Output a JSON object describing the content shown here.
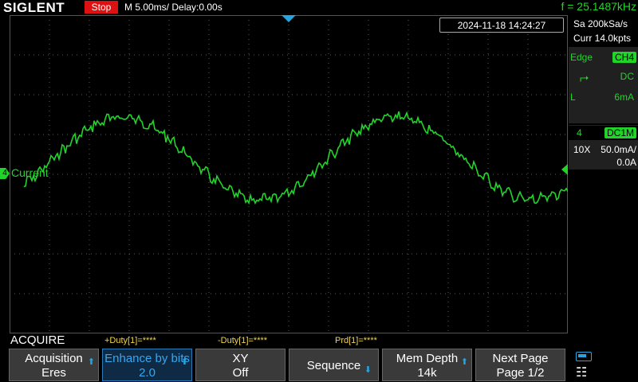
{
  "header": {
    "brand": "SIGLENT",
    "run_state": "Stop",
    "timebase": "M 5.00ms/ Delay:0.00s",
    "frequency": "f = 25.1487kHz"
  },
  "datetime": "2024-11-18 14:24:27",
  "acquisition_info": {
    "sample_rate": "Sa 200kSa/s",
    "memory": "Curr 14.0kpts"
  },
  "trigger": {
    "type": "Edge",
    "source": "CH4",
    "slope_symbol": "⮣",
    "coupling": "DC",
    "level_label": "L",
    "level": "6mA"
  },
  "channel": {
    "number": "4",
    "name": "Current",
    "coupling": "DC1M",
    "probe": "10X",
    "scale": "50.0mA/",
    "offset": "0.0A"
  },
  "bottom": {
    "mode_title": "ACQUIRE",
    "measurements": [
      "+Duty[1]=****",
      "-Duty[1]=****",
      "Prd[1]=****"
    ]
  },
  "softkeys": [
    {
      "line1": "Acquisition",
      "line2": "Eres"
    },
    {
      "line1": "Enhance by bits",
      "line2": "2.0"
    },
    {
      "line1": "XY",
      "line2": "Off"
    },
    {
      "line1": "Sequence",
      "line2": ""
    },
    {
      "line1": "Mem Depth",
      "line2": "14k"
    },
    {
      "line1": "Next Page",
      "line2": "Page 1/2"
    }
  ],
  "colors": {
    "trace": "#21d42a",
    "accent": "#27a4dd",
    "stop": "#dd1111",
    "measure": "#f4d64a"
  }
}
